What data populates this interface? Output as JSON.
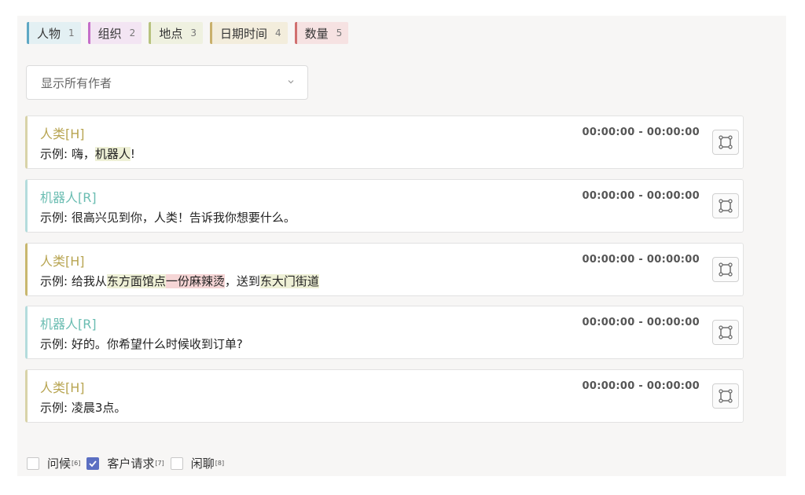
{
  "labels": [
    {
      "name": "人物",
      "hotkey": "1",
      "color": "#5fa8c4",
      "bg": "#e3f0f3"
    },
    {
      "name": "组织",
      "hotkey": "2",
      "color": "#c56fc9",
      "bg": "#f3e5f3"
    },
    {
      "name": "地点",
      "hotkey": "3",
      "color": "#b7c27e",
      "bg": "#eff1e0"
    },
    {
      "name": "日期时间",
      "hotkey": "4",
      "color": "#c9b06c",
      "bg": "#f3eddc"
    },
    {
      "name": "数量",
      "hotkey": "5",
      "color": "#d07070",
      "bg": "#f6e2e2"
    }
  ],
  "author_filter": {
    "value": "显示所有作者"
  },
  "messages": [
    {
      "speaker": "人类[H]",
      "role": "human",
      "prefix": "示例: 嗨，",
      "segments": [
        {
          "t": "机器人",
          "hl": "loc"
        },
        {
          "t": "!",
          "hl": ""
        }
      ],
      "time": "00:00:00 - 00:00:00"
    },
    {
      "speaker": "机器人[R]",
      "role": "robot",
      "prefix": "示例: 很高兴见到你，人类！告诉我你想要什么。",
      "segments": [],
      "time": "00:00:00 - 00:00:00"
    },
    {
      "speaker": "人类[H]",
      "role": "human",
      "prefix": "示例: 给我从",
      "segments": [
        {
          "t": "东方面馆点",
          "hl": "loc"
        },
        {
          "t": "一份麻辣烫",
          "hl": "qty"
        },
        {
          "t": "，送到",
          "hl": ""
        },
        {
          "t": "东大门街道",
          "hl": "loc"
        }
      ],
      "time": "00:00:00 - 00:00:00"
    },
    {
      "speaker": "机器人[R]",
      "role": "robot",
      "prefix": "示例: 好的。你希望什么时候收到订单?",
      "segments": [],
      "time": "00:00:00 - 00:00:00"
    },
    {
      "speaker": "人类[H]",
      "role": "human",
      "prefix": "示例: 凌晨3点。",
      "segments": [],
      "time": "00:00:00 - 00:00:00"
    }
  ],
  "tags": [
    {
      "label": "问候",
      "hotkey": "[6]",
      "checked": false
    },
    {
      "label": "客户请求",
      "hotkey": "[7]",
      "checked": true
    },
    {
      "label": "闲聊",
      "hotkey": "[8]",
      "checked": false
    }
  ]
}
